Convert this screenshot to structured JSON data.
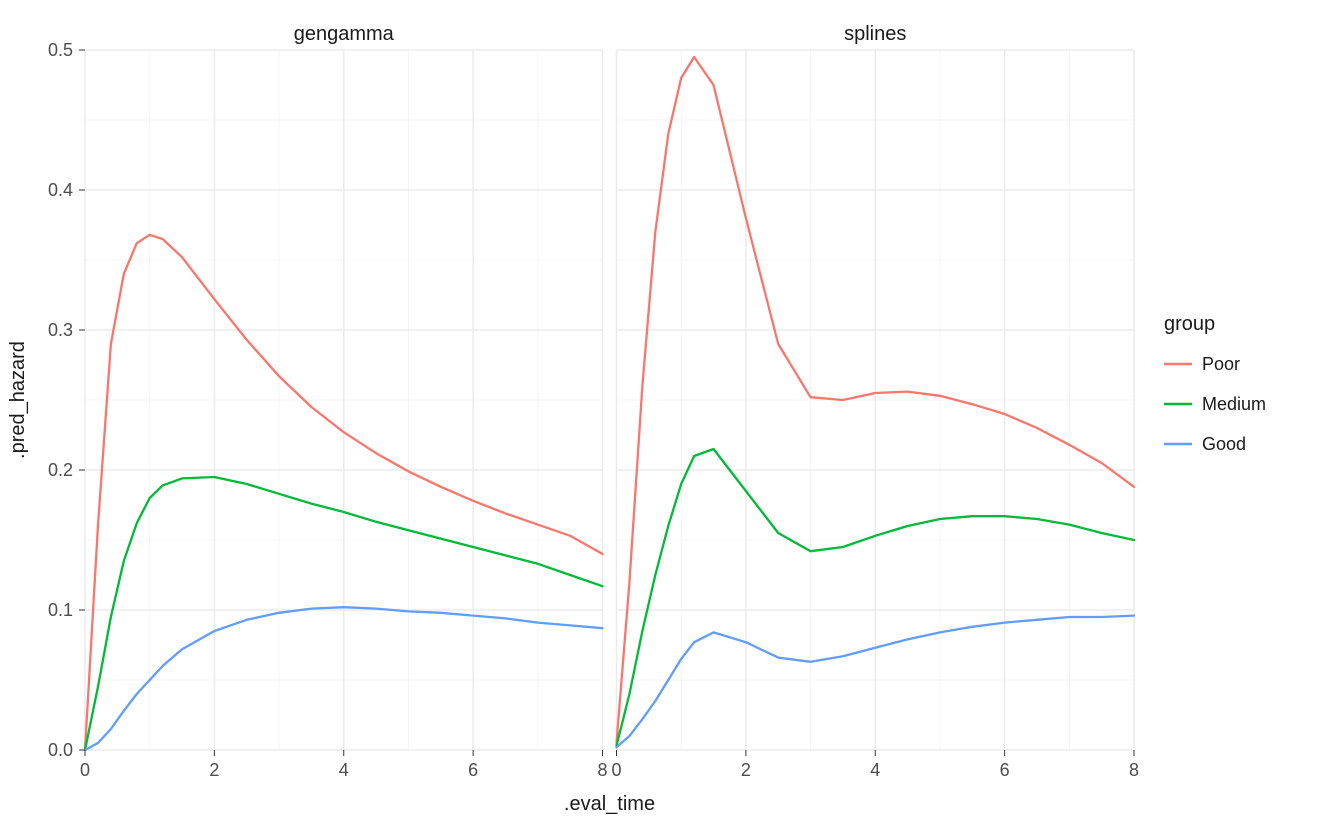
{
  "axis": {
    "xlabel": ".eval_time",
    "ylabel": ".pred_hazard"
  },
  "legend": {
    "title": "group",
    "items": [
      "Poor",
      "Medium",
      "Good"
    ]
  },
  "colors": {
    "Poor": "#f8766d",
    "Medium": "#00ba38",
    "Good": "#619cff"
  },
  "facets": [
    "gengamma",
    "splines"
  ],
  "y_ticks": [
    0.0,
    0.1,
    0.2,
    0.3,
    0.4,
    0.5
  ],
  "x_ticks": [
    0,
    2,
    4,
    6,
    8
  ],
  "chart_data": [
    {
      "facet": "gengamma",
      "type": "line",
      "xlabel": ".eval_time",
      "ylabel": ".pred_hazard",
      "xlim": [
        0,
        8
      ],
      "ylim": [
        0,
        0.5
      ],
      "x": [
        0,
        0.2,
        0.4,
        0.6,
        0.8,
        1.0,
        1.2,
        1.5,
        2.0,
        2.5,
        3.0,
        3.5,
        4.0,
        4.5,
        5.0,
        5.5,
        6.0,
        6.5,
        7.0,
        7.5,
        8.0
      ],
      "series": [
        {
          "name": "Poor",
          "values": [
            0.0,
            0.16,
            0.29,
            0.34,
            0.362,
            0.368,
            0.365,
            0.352,
            0.322,
            0.293,
            0.267,
            0.245,
            0.227,
            0.212,
            0.199,
            0.188,
            0.178,
            0.169,
            0.161,
            0.153,
            0.14
          ]
        },
        {
          "name": "Medium",
          "values": [
            0.0,
            0.045,
            0.095,
            0.135,
            0.162,
            0.18,
            0.189,
            0.194,
            0.195,
            0.19,
            0.183,
            0.176,
            0.17,
            0.163,
            0.157,
            0.151,
            0.145,
            0.139,
            0.133,
            0.125,
            0.117
          ]
        },
        {
          "name": "Good",
          "values": [
            0.0,
            0.005,
            0.015,
            0.028,
            0.04,
            0.05,
            0.06,
            0.072,
            0.085,
            0.093,
            0.098,
            0.101,
            0.102,
            0.101,
            0.099,
            0.098,
            0.096,
            0.094,
            0.091,
            0.089,
            0.087
          ]
        }
      ]
    },
    {
      "facet": "splines",
      "type": "line",
      "xlabel": ".eval_time",
      "ylabel": ".pred_hazard",
      "xlim": [
        0,
        8
      ],
      "ylim": [
        0,
        0.5
      ],
      "x": [
        0,
        0.2,
        0.4,
        0.6,
        0.8,
        1.0,
        1.2,
        1.5,
        2.0,
        2.5,
        3.0,
        3.5,
        4.0,
        4.5,
        5.0,
        5.5,
        6.0,
        6.5,
        7.0,
        7.5,
        8.0
      ],
      "series": [
        {
          "name": "Poor",
          "values": [
            0.005,
            0.12,
            0.26,
            0.37,
            0.44,
            0.48,
            0.495,
            0.475,
            0.38,
            0.29,
            0.252,
            0.25,
            0.255,
            0.256,
            0.253,
            0.247,
            0.24,
            0.23,
            0.218,
            0.205,
            0.188
          ]
        },
        {
          "name": "Medium",
          "values": [
            0.003,
            0.04,
            0.085,
            0.125,
            0.16,
            0.19,
            0.21,
            0.215,
            0.185,
            0.155,
            0.142,
            0.145,
            0.153,
            0.16,
            0.165,
            0.167,
            0.167,
            0.165,
            0.161,
            0.155,
            0.15
          ]
        },
        {
          "name": "Good",
          "values": [
            0.002,
            0.01,
            0.022,
            0.035,
            0.05,
            0.065,
            0.077,
            0.084,
            0.077,
            0.066,
            0.063,
            0.067,
            0.073,
            0.079,
            0.084,
            0.088,
            0.091,
            0.093,
            0.095,
            0.095,
            0.096
          ]
        }
      ]
    }
  ]
}
